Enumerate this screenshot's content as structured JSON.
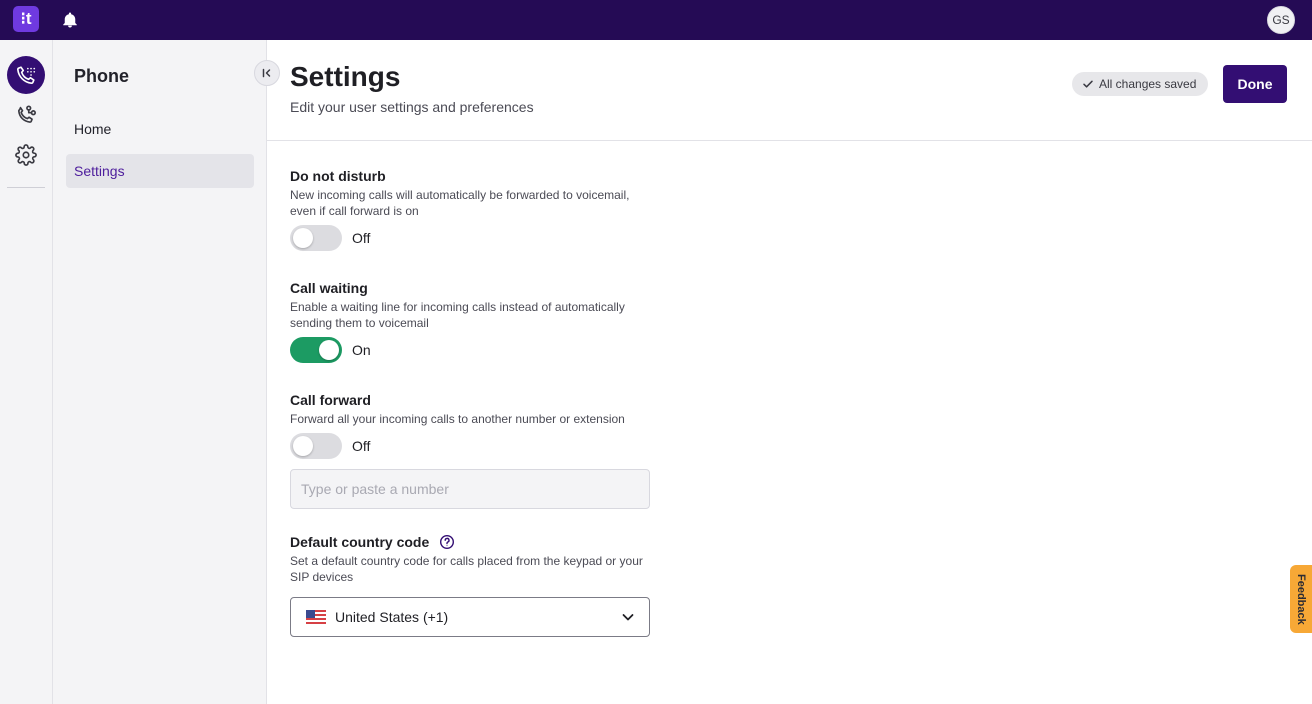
{
  "topbar": {
    "logo_text": "⁝t",
    "bell_icon": "bell-icon",
    "avatar_initials": "GS"
  },
  "rail": {
    "items": [
      {
        "icon": "phone-keypad-icon",
        "active": true
      },
      {
        "icon": "call-routing-icon",
        "active": false
      },
      {
        "icon": "gear-icon",
        "active": false
      }
    ]
  },
  "sidenav": {
    "title": "Phone",
    "items": [
      {
        "label": "Home",
        "active": false
      },
      {
        "label": "Settings",
        "active": true
      }
    ],
    "collapse_icon": "collapse-left-icon"
  },
  "header": {
    "title": "Settings",
    "subtitle": "Edit your user settings and preferences",
    "status_badge": "All changes saved",
    "done_label": "Done"
  },
  "settings": {
    "dnd": {
      "label": "Do not disturb",
      "description": "New incoming calls will automatically be forwarded to voicemail, even if call forward is on",
      "state": "Off",
      "enabled": false
    },
    "call_waiting": {
      "label": "Call waiting",
      "description": "Enable a waiting line for incoming calls instead of automatically sending them to voicemail",
      "state": "On",
      "enabled": true
    },
    "call_forward": {
      "label": "Call forward",
      "description": "Forward all your incoming calls to another number or extension",
      "state": "Off",
      "enabled": false,
      "input_value": "",
      "input_placeholder": "Type or paste a number"
    },
    "country_code": {
      "label": "Default country code",
      "description": "Set a default country code for calls placed from the keypad or your SIP devices",
      "selected": "United States (+1)",
      "flag_icon": "us-flag-icon"
    }
  },
  "feedback_label": "Feedback",
  "colors": {
    "topbar": "#250b55",
    "accent": "#330e73",
    "toggle_on": "#1c9b63",
    "feedback": "#f7a836"
  }
}
